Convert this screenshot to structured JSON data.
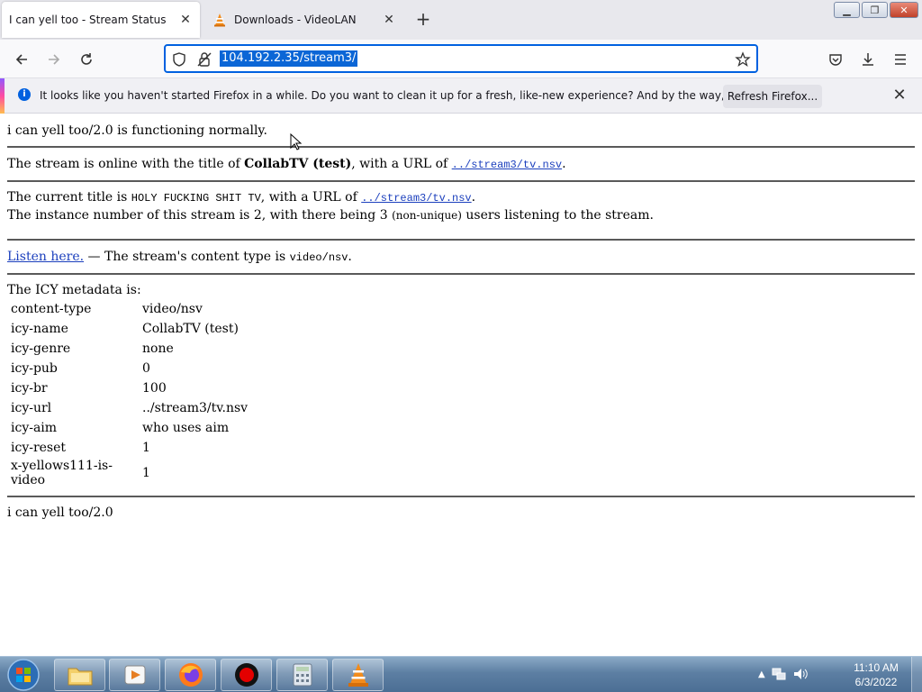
{
  "browser": {
    "tabs": [
      {
        "title": "I can yell too - Stream Status",
        "active": true
      },
      {
        "title": "Downloads - VideoLAN",
        "active": false
      }
    ],
    "new_tab_label": "+",
    "url": "104.192.2.35/stream3/",
    "notification": {
      "message": "It looks like you haven't started Firefox in a while. Do you want to clean it up for a fresh, like-new experience? And by the way, welcome back!",
      "button": "Refresh Firefox..."
    }
  },
  "page": {
    "status_line": "i can yell too/2.0 is functioning normally.",
    "online": {
      "prefix": "The stream is online with the title of ",
      "title": "CollabTV (test)",
      "middle": ", with a URL of ",
      "url": "../stream3/tv.nsv",
      "suffix": "."
    },
    "current": {
      "prefix": "The current title is ",
      "title": "HOLY FUCKING SHIT TV",
      "middle": ", with a URL of ",
      "url": "../stream3/tv.nsv",
      "suffix": "."
    },
    "instance": {
      "prefix": "The instance number of this stream is 2, with there being 3 ",
      "small": "(non-unique)",
      "suffix": " users listening to the stream."
    },
    "listen": {
      "link": "Listen here.",
      "middle": " — The stream's content type is ",
      "type": "video/nsv",
      "suffix": "."
    },
    "icy_heading": "The ICY metadata is:",
    "icy": [
      {
        "key": "content-type",
        "value": "video/nsv"
      },
      {
        "key": "icy-name",
        "value": "CollabTV (test)"
      },
      {
        "key": "icy-genre",
        "value": "none"
      },
      {
        "key": "icy-pub",
        "value": "0"
      },
      {
        "key": "icy-br",
        "value": "100"
      },
      {
        "key": "icy-url",
        "value": "../stream3/tv.nsv"
      },
      {
        "key": "icy-aim",
        "value": "who uses aim"
      },
      {
        "key": "icy-reset",
        "value": "1"
      },
      {
        "key": "x-yellows111-is-video",
        "value": "1"
      }
    ],
    "footer": "i can yell too/2.0"
  },
  "taskbar": {
    "time": "11:10 AM",
    "date": "6/3/2022"
  },
  "colors": {
    "url_highlight": "#0b66d6",
    "link": "#1b3fbd",
    "taskbar": "#5d7fa3"
  }
}
